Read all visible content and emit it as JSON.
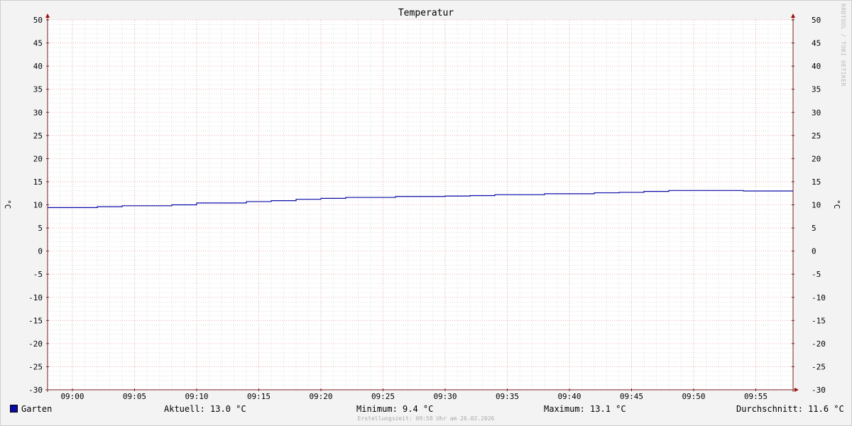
{
  "chart_data": {
    "type": "line",
    "title": "Temperatur",
    "ylabel": "°C",
    "ylim": [
      -30,
      50
    ],
    "yticks": [
      50,
      45,
      40,
      35,
      30,
      25,
      20,
      15,
      10,
      5,
      0,
      -5,
      -10,
      -15,
      -20,
      -25,
      -30
    ],
    "ytick_labels": [
      "50",
      "45",
      "40",
      "35",
      "30",
      "25",
      "20",
      "15",
      "10",
      "5",
      "0",
      "-5",
      "-10",
      "-15",
      "-20",
      "-25",
      "-30"
    ],
    "xlim": [
      "08:58",
      "09:58"
    ],
    "xticks": [
      "09:00",
      "09:05",
      "09:10",
      "09:15",
      "09:20",
      "09:25",
      "09:30",
      "09:35",
      "09:40",
      "09:45",
      "09:50",
      "09:55"
    ],
    "grid": true,
    "series": [
      {
        "name": "Garten",
        "color": "#0a0aa8",
        "step": true,
        "x": [
          "08:58",
          "09:02",
          "09:04",
          "09:08",
          "09:10",
          "09:14",
          "09:16",
          "09:18",
          "09:20",
          "09:22",
          "09:26",
          "09:30",
          "09:32",
          "09:34",
          "09:38",
          "09:42",
          "09:44",
          "09:46",
          "09:48",
          "09:54",
          "09:58"
        ],
        "values": [
          9.4,
          9.6,
          9.8,
          10.0,
          10.4,
          10.7,
          10.9,
          11.2,
          11.4,
          11.6,
          11.8,
          11.9,
          12.0,
          12.2,
          12.4,
          12.6,
          12.7,
          12.9,
          13.1,
          13.0,
          13.0
        ]
      }
    ]
  },
  "watermark": "RRDTOOL / TOBI OETIKER",
  "legend": {
    "series_name": "Garten",
    "current": "Aktuell: 13.0 °C",
    "minimum": "Minimum: 9.4 °C",
    "maximum": "Maximum: 13.1 °C",
    "average": "Durchschnitt: 11.6 °C"
  },
  "footer": "Erstellungszeit: 09:58 Uhr am 26.02.2026",
  "colors": {
    "background": "#f3f3f3",
    "plot_background": "#ffffff",
    "minor_grid": "#cfcfcf",
    "major_grid": "#e8a0a0",
    "axis": "#7a2020",
    "line": "#0a0aa8"
  }
}
